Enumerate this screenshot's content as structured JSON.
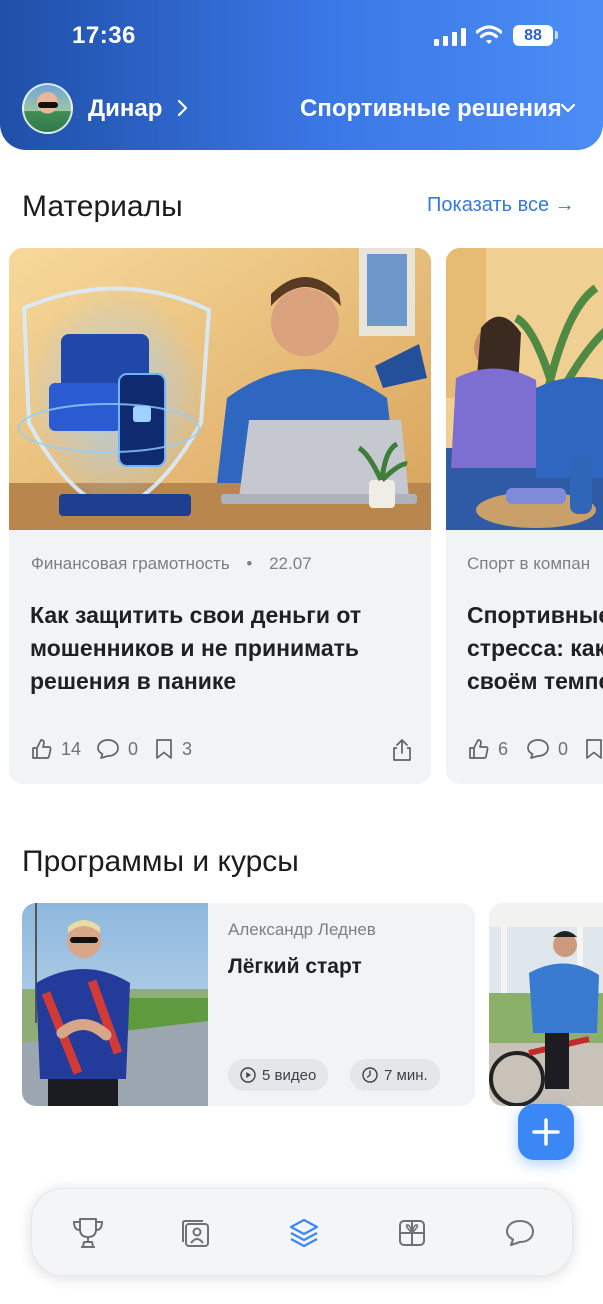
{
  "status_bar": {
    "time": "17:36",
    "battery": "88"
  },
  "header": {
    "user_name": "Динар",
    "org_name": "Спортивные решения"
  },
  "materials": {
    "title": "Материалы",
    "show_all": "Показать все →",
    "cards": [
      {
        "category": "Финансовая грамотность",
        "date": "22.07",
        "title": "Как защитить свои деньги от мошенников и не принимать решения в панике",
        "likes": "14",
        "comments": "0",
        "bookmarks": "3"
      },
      {
        "category": "Спорт в компан",
        "title": "Спортивные стресса: как своём темпе",
        "likes": "6",
        "comments": "0"
      }
    ]
  },
  "courses": {
    "title": "Программы и курсы",
    "items": [
      {
        "author": "Александр Леднев",
        "title": "Лёгкий старт",
        "videos": "5 видео",
        "duration": "7 мин."
      }
    ]
  },
  "tabbar": {
    "icons": [
      "trophy-icon",
      "profile-card-icon",
      "layers-icon",
      "gift-icon",
      "chat-icon"
    ],
    "active": "layers-icon",
    "active_color": "#3a87f5"
  }
}
